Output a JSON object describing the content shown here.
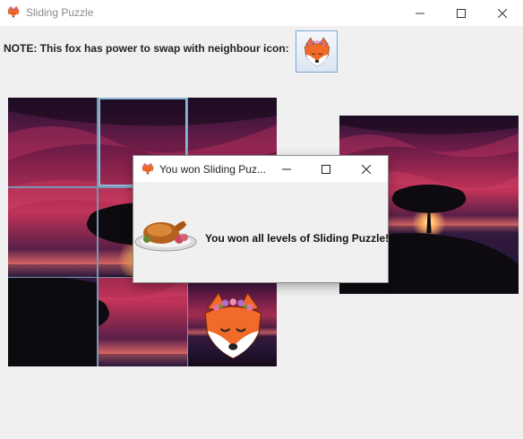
{
  "window": {
    "title": "Sliding Puzzle",
    "icon": "fox-icon",
    "controls": [
      "minimize-icon",
      "maximize-icon",
      "close-icon"
    ]
  },
  "note": {
    "text": "NOTE: This fox has power to swap with neighbour icon:",
    "button_icon": "fox-icon"
  },
  "puzzle": {
    "grid": "3x3",
    "tiles": [
      "image-piece-1",
      "image-piece-2",
      "image-piece-3",
      "image-piece-4",
      "image-piece-5",
      "image-piece-6",
      "image-piece-7",
      "image-piece-8",
      "fox-tile"
    ],
    "selected_tile": 2
  },
  "preview": {
    "icon": "tree-sunset-image"
  },
  "dialog": {
    "title": "You won Sliding Puz...",
    "icon": "fox-icon",
    "image": "roast-turkey-image",
    "message": "You won all levels of Sliding Puzzle!",
    "controls": [
      "minimize-icon",
      "maximize-icon",
      "close-icon"
    ]
  },
  "colors": {
    "background": "#f0f0f0",
    "titlebar": "#ffffff",
    "sky_dark": "#2a1238",
    "sky_pink": "#c0305a",
    "fox_orange": "#f26a2a"
  }
}
